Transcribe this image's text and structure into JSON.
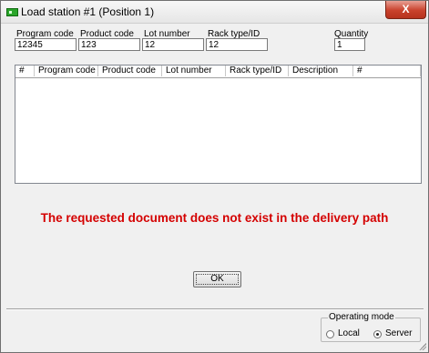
{
  "window": {
    "title": "Load station #1 (Position 1)",
    "close_label": "X"
  },
  "fields": {
    "program_code": {
      "label": "Program code",
      "value": "12345"
    },
    "product_code": {
      "label": "Product code",
      "value": "123"
    },
    "lot_number": {
      "label": "Lot number",
      "value": "12"
    },
    "rack_type": {
      "label": "Rack type/ID",
      "value": "12"
    },
    "quantity": {
      "label": "Quantity",
      "value": "1"
    }
  },
  "table": {
    "columns": [
      "#",
      "Program code",
      "Product code",
      "Lot number",
      "Rack type/ID",
      "Description",
      "#"
    ],
    "rows": []
  },
  "message": "The requested document does not exist in the delivery path",
  "ok_label": "OK",
  "operating_mode": {
    "title": "Operating mode",
    "options": [
      "Local",
      "Server"
    ],
    "selected": "Server"
  },
  "colors": {
    "message": "#d40000",
    "close_button": "#c9422c",
    "title_icon": "#2aa52a"
  }
}
